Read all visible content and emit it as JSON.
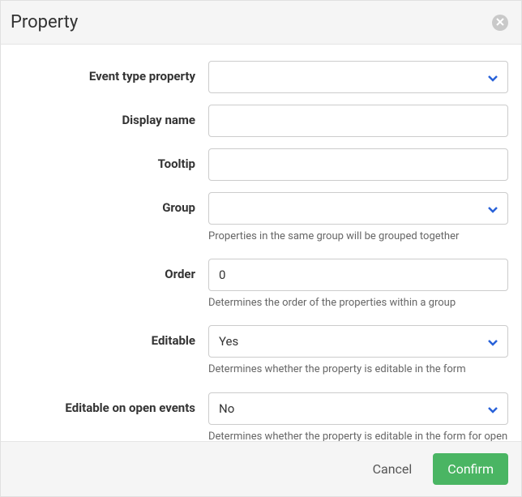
{
  "modal": {
    "title": "Property",
    "fields": {
      "event_type_property": {
        "label": "Event type property",
        "value": ""
      },
      "display_name": {
        "label": "Display name",
        "value": ""
      },
      "tooltip": {
        "label": "Tooltip",
        "value": ""
      },
      "group": {
        "label": "Group",
        "value": "",
        "help": "Properties in the same group will be grouped together"
      },
      "order": {
        "label": "Order",
        "value": "0",
        "help": "Determines the order of the properties within a group"
      },
      "editable": {
        "label": "Editable",
        "value": "Yes",
        "help": "Determines whether the property is editable in the form"
      },
      "editable_open": {
        "label": "Editable on open events",
        "value": "No",
        "help": "Determines whether the property is editable in the form for open events"
      }
    },
    "buttons": {
      "cancel": "Cancel",
      "confirm": "Confirm"
    }
  }
}
